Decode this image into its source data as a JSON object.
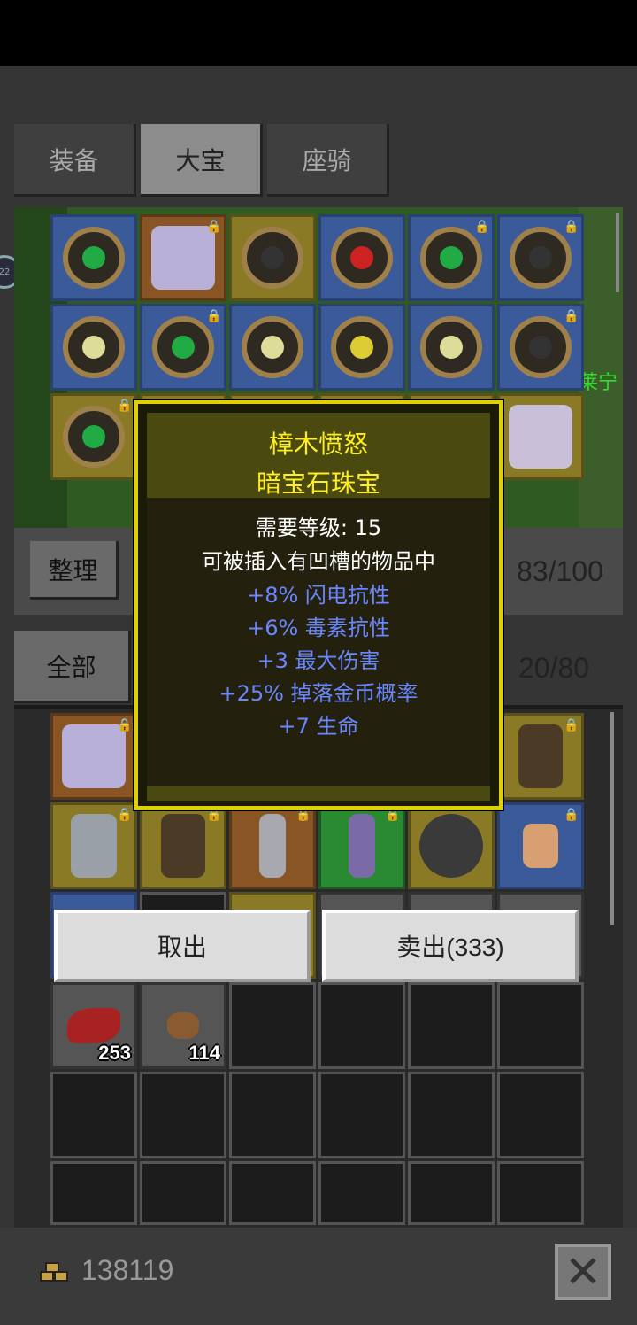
{
  "tabs": [
    {
      "label": "装备",
      "active": false
    },
    {
      "label": "大宝",
      "active": true
    },
    {
      "label": "座骑",
      "active": false
    }
  ],
  "scene": {
    "npc_name": "莱宁",
    "side_badge": "22"
  },
  "stash": {
    "sort_label": "整理",
    "count": "83/100"
  },
  "inventory": {
    "filter_label": "全部",
    "count": "20/80"
  },
  "tooltip": {
    "name": "樟木愤怒",
    "type": "暗宝石珠宝",
    "required_level": "需要等级: 15",
    "socket_note": "可被插入有凹槽的物品中",
    "stats": [
      "+8% 闪电抗性",
      "+6% 毒素抗性",
      "+3 最大伤害",
      "+25% 掉落金币概率",
      "+7 生命"
    ],
    "name_color": "#ffee22",
    "stat_color": "#6a86ff"
  },
  "actions": {
    "take_label": "取出",
    "sell_label": "卖出(333)"
  },
  "materials": [
    {
      "name": "red-leaf",
      "qty": "253"
    },
    {
      "name": "brown-ore",
      "qty": "114"
    }
  ],
  "footer": {
    "gold": "138119"
  }
}
